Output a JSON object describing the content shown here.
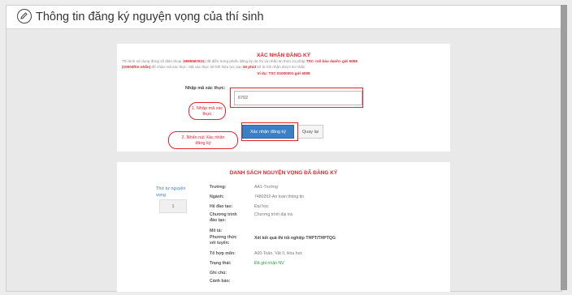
{
  "header": {
    "title": "Thông tin đăng ký nguyện vọng của thí sinh",
    "icon": "edit-icon"
  },
  "confirm": {
    "title": "XÁC NHẬN ĐĂNG KÝ",
    "note_part1": "Thí sinh sử dụng đúng số điện thoại (",
    "phone": "0989587611",
    "note_part2": ") đã điền trong phiếu đăng ký dự thi và nhắn tin theo cú pháp ",
    "syntax": "TSC <số báo danh> gửi 6058",
    "note_line2_start": "(1000đ/tin nhắn)",
    "note_line2_mid": " để nhận mã xác thực. Mã xác thực sẽ hết hiệu lực sau ",
    "expire": "30 phút",
    "note_line2_end": " kể từ khi nhận được tin nhắn",
    "example": "Ví dụ: TSC 01000001 gửi 6058",
    "code_label": "Nhập mã xác thực:",
    "code_value": "6702",
    "callout1": "1. Nhập mã xác thực",
    "callout2": "2. Nhấn nút Xác nhận đăng ký",
    "submit_label": "Xác nhận đăng ký",
    "back_label": "Quay lại"
  },
  "list": {
    "title": "DANH SÁCH NGUYỆN VỌNG ĐÃ ĐĂNG KÝ",
    "order_label": "Thứ tự nguyện vọng",
    "order_value": "1",
    "rows": [
      {
        "label": "Trường:",
        "value": "AA1-Trường"
      },
      {
        "label": "Ngành:",
        "value": "7480202-An toàn thông tin"
      },
      {
        "label": "Hệ đào tạo:",
        "value": "Đại học"
      },
      {
        "label": "Chương trình đào tạo:",
        "value": "Chương trình đại trà"
      },
      {
        "label": "Mô tả:",
        "value": ""
      },
      {
        "label": "Phương thức xét tuyển:",
        "value": "Xét kết quả thi tốt nghiệp THPT/THPTQG"
      },
      {
        "label": "Tổ hợp môn:",
        "value": "A00-Toán, Vật lí, Hóa học"
      },
      {
        "label": "Trạng thái:",
        "value": "Đã ghi nhận NV"
      },
      {
        "label": "Ghi chú:",
        "value": ""
      },
      {
        "label": "Cảnh báo:",
        "value": ""
      }
    ]
  },
  "colors": {
    "accent_red": "#e8232b",
    "primary_blue": "#3b7fc4",
    "status_green": "#2e9e3c"
  }
}
